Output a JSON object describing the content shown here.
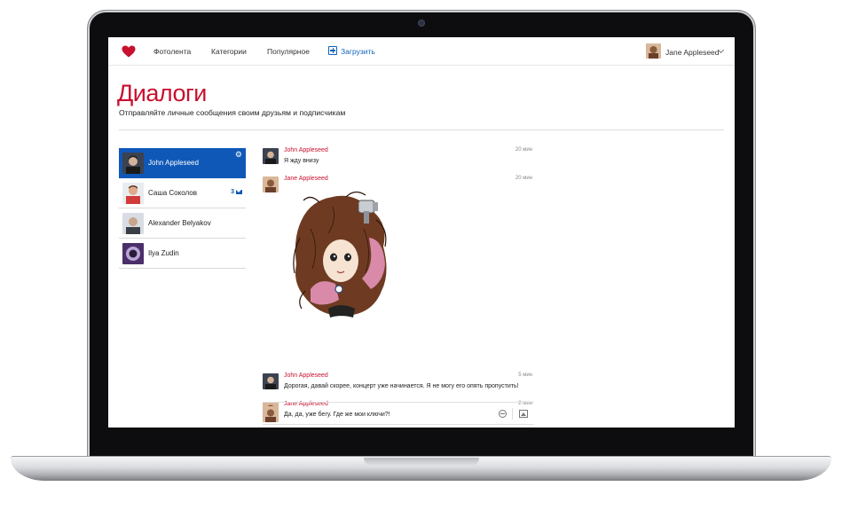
{
  "app": {
    "brand_color": "#c8102e",
    "accent_color": "#0f58b8",
    "logo_icon": "heart-icon"
  },
  "nav": {
    "items": [
      {
        "label": "Фотолента"
      },
      {
        "label": "Категории"
      },
      {
        "label": "Популярное"
      }
    ],
    "upload_label": "Загрузить",
    "upload_icon": "plus-square-icon"
  },
  "user": {
    "name": "Jane Appleseed",
    "menu_icon": "chevron-down-icon"
  },
  "page": {
    "title": "Диалоги",
    "subtitle": "Отправляйте личные сообщения своим друзьям и подписчикам"
  },
  "dialogs": [
    {
      "name": "John Appleseed",
      "active": true,
      "action_icon": "gear-icon"
    },
    {
      "name": "Саша Соколов",
      "unread": "3",
      "unread_icon": "envelope-icon"
    },
    {
      "name": "Alexander Belyakov"
    },
    {
      "name": "Ilya Zudin"
    }
  ],
  "messages": [
    {
      "author": "John Appleseed",
      "time": "20 мин",
      "text": "Я жду внизу"
    },
    {
      "author": "Jane Appleseed",
      "time": "20 мин",
      "text": "",
      "attachment": "sticker-image"
    },
    {
      "author": "John Appleseed",
      "time": "5 мин",
      "text": "Дорогая, давай скорее, концерт уже начинается. Я не могу его опять пропустить!"
    },
    {
      "author": "Jane Appleseed",
      "time": "2 мин",
      "text": "Да, да, уже бегу. Где же мои ключи?!"
    }
  ],
  "composer": {
    "placeholder": "",
    "emoji_icon": "smile-icon",
    "attach_icon": "image-icon"
  }
}
